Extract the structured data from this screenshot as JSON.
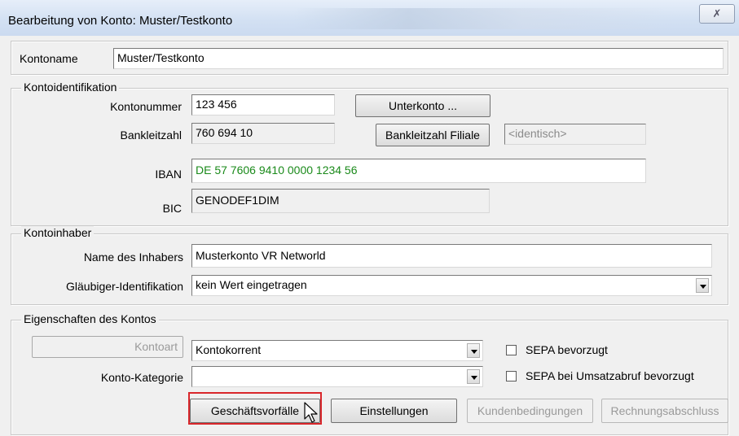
{
  "window": {
    "title": "Bearbeitung von Konto:  Muster/Testkonto",
    "close_glyph": "✗"
  },
  "kontoname": {
    "label": "Kontoname",
    "value": "Muster/Testkonto"
  },
  "kontoidentifikation": {
    "legend": "Kontoidentifikation",
    "kontonummer_label": "Kontonummer",
    "kontonummer_value": "123 456",
    "unterkonto_button": "Unterkonto ...",
    "bankleitzahl_label": "Bankleitzahl",
    "bankleitzahl_value": "760 694 10",
    "blz_filiale_button": "Bankleitzahl Filiale",
    "filiale_value": "<identisch>",
    "iban_label": "IBAN",
    "iban_value": "DE 57 7606 9410 0000 1234 56",
    "bic_label": "BIC",
    "bic_value": "GENODEF1DIM"
  },
  "kontoinhaber": {
    "legend": "Kontoinhaber",
    "name_label": "Name des Inhabers",
    "name_value": "Musterkonto VR Networld",
    "glaeubiger_label": "Gläubiger-Identifikation",
    "glaeubiger_value": "kein Wert eingetragen"
  },
  "eigenschaften": {
    "legend": "Eigenschaften des Kontos",
    "kontoart_button": "Kontoart",
    "kontoart_value": "Kontokorrent",
    "kategorie_label": "Konto-Kategorie",
    "kategorie_value": "",
    "sepa_bevorzugt_label": "SEPA bevorzugt",
    "sepa_bevorzugt_checked": false,
    "sepa_umsatz_label": "SEPA bei Umsatzabruf bevorzugt",
    "sepa_umsatz_checked": false
  },
  "buttons": {
    "geschaeftsvorfaelle": "Geschäftsvorfälle",
    "einstellungen": "Einstellungen",
    "kundenbedingungen": "Kundenbedingungen",
    "rechnungsabschluss": "Rechnungsabschluss"
  },
  "colors": {
    "highlight": "#d9262b",
    "iban_text": "#1a8a1a"
  }
}
